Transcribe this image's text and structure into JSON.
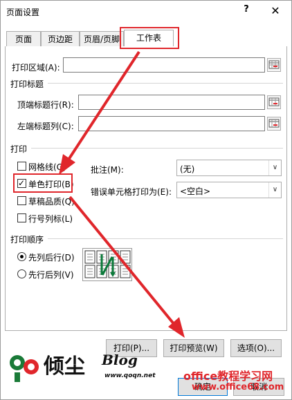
{
  "title": "页面设置",
  "help_glyph": "?",
  "close_glyph": "✕",
  "tabs": [
    {
      "label": "页面"
    },
    {
      "label": "页边距"
    },
    {
      "label": "页眉/页脚"
    },
    {
      "label": "工作表"
    }
  ],
  "print_area": {
    "label": "打印区域(A):",
    "value": ""
  },
  "print_titles": {
    "section": "打印标题",
    "rows": {
      "label": "顶端标题行(R):",
      "value": ""
    },
    "cols": {
      "label": "左端标题列(C):",
      "value": ""
    }
  },
  "print": {
    "section": "打印",
    "gridlines": {
      "label": "网格线(G)",
      "checked": false
    },
    "black_white": {
      "label": "单色打印(B)",
      "checked": true
    },
    "draft": {
      "label": "草稿品质(Q)",
      "checked": false
    },
    "headings": {
      "label": "行号列标(L)",
      "checked": false
    },
    "comments": {
      "label": "批注(M):",
      "value": "(无)"
    },
    "errors": {
      "label": "错误单元格打印为(E):",
      "value": "<空白>"
    },
    "check_glyph": "✓",
    "dropdown_glyph": "∨"
  },
  "page_order": {
    "section": "打印顺序",
    "down_then_over": {
      "label": "先列后行(D)",
      "selected": true
    },
    "over_then_down": {
      "label": "先行后列(V)",
      "selected": false
    }
  },
  "buttons": {
    "print": "打印(P)...",
    "preview": "打印预览(W)",
    "options": "选项(O)...",
    "ok": "确定",
    "cancel": "取消"
  },
  "watermark": {
    "logo_text": "倾尘",
    "blog": "Blog",
    "blog_url": "www.qoqn.net",
    "site_name": "office教程学习网",
    "site_url": "www.office68.com"
  },
  "colors": {
    "annotation_red": "#e0262b",
    "focus_blue": "#0078d7"
  }
}
